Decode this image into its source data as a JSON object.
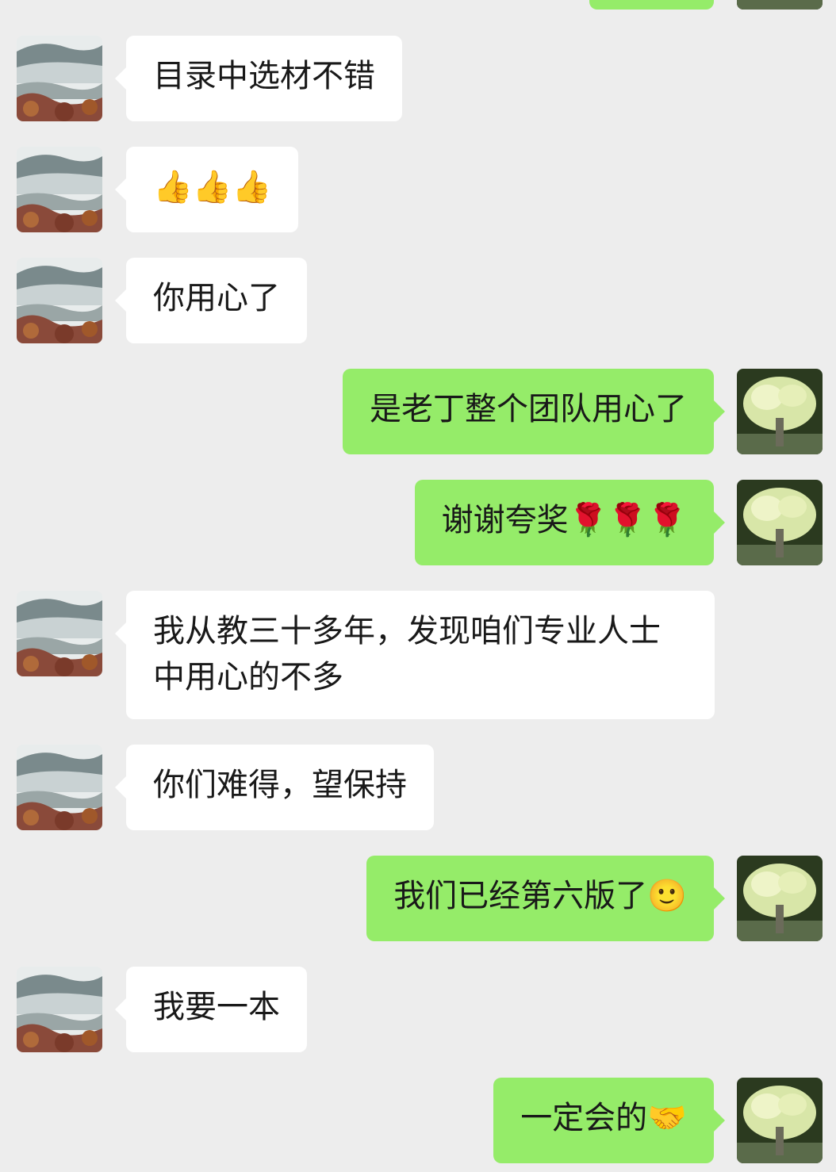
{
  "messages": [
    {
      "side": "in",
      "text": "目录中选材不错"
    },
    {
      "side": "in",
      "text": "👍👍👍"
    },
    {
      "side": "in",
      "text": "你用心了"
    },
    {
      "side": "out",
      "text": "是老丁整个团队用心了"
    },
    {
      "side": "out",
      "text": "谢谢夸奖🌹🌹🌹"
    },
    {
      "side": "in",
      "text": "我从教三十多年，发现咱们专业人士中用心的不多"
    },
    {
      "side": "in",
      "text": "你们难得，望保持"
    },
    {
      "side": "out",
      "text": "我们已经第六版了🙂"
    },
    {
      "side": "in",
      "text": "我要一本"
    },
    {
      "side": "out",
      "text": "一定会的🤝"
    }
  ],
  "colors": {
    "background": "#ededed",
    "incoming_bubble": "#ffffff",
    "outgoing_bubble": "#95ec69",
    "text": "#191919"
  },
  "avatars": {
    "incoming": "misty-mountain-landscape-avatar",
    "outgoing": "flowering-tree-avatar"
  }
}
